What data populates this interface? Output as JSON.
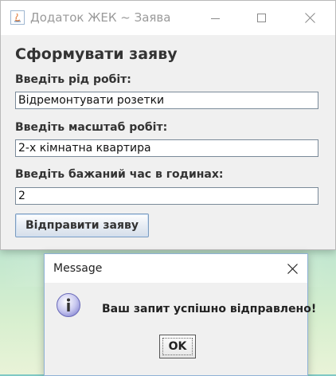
{
  "main_window": {
    "title": "Додаток ЖЕК ~ Заява",
    "heading": "Сформувати заяву",
    "fields": [
      {
        "label": "Введіть рід робіт:",
        "value": "Відремонтувати розетки"
      },
      {
        "label": "Введіть масштаб робіт:",
        "value": "2-х кімнатна квартира"
      },
      {
        "label": "Введіть бажаний час в годинах:",
        "value": "2"
      }
    ],
    "submit_label": "Відправити заяву",
    "controls": {
      "minimize_icon": "minimize-icon",
      "maximize_icon": "maximize-icon",
      "close_icon": "close-icon"
    }
  },
  "dialog": {
    "title": "Message",
    "message": "Ваш запит успішно відправлено!",
    "ok_label": "OK",
    "icon": "info-icon"
  },
  "colors": {
    "window_bg": "#f0f0f0",
    "titlebar_bg": "#ffffff",
    "button_border": "#7c9cbf",
    "info_icon": "#8f8fd6"
  }
}
